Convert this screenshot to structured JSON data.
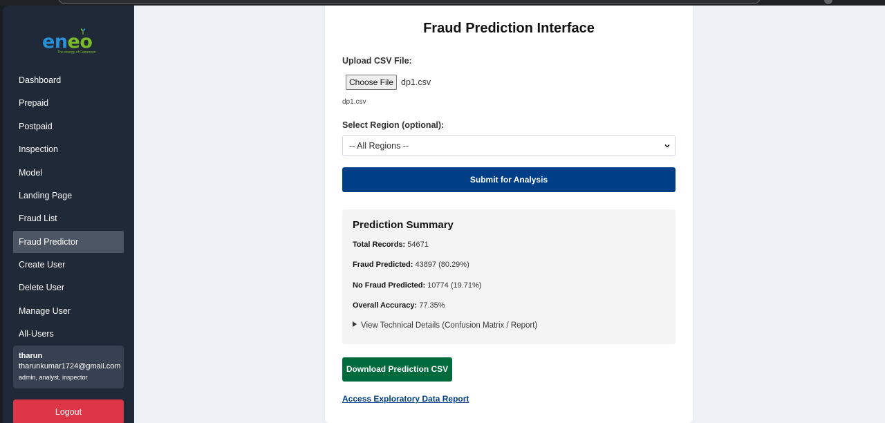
{
  "brand": {
    "logo_word": [
      "e",
      "n",
      "e",
      "o"
    ],
    "tagline": "The energy of Cameroon"
  },
  "sidebar": {
    "items": [
      {
        "label": "Dashboard",
        "active": false
      },
      {
        "label": "Prepaid",
        "active": false
      },
      {
        "label": "Postpaid",
        "active": false
      },
      {
        "label": "Inspection",
        "active": false
      },
      {
        "label": "Model",
        "active": false
      },
      {
        "label": "Landing Page",
        "active": false
      },
      {
        "label": "Fraud List",
        "active": false
      },
      {
        "label": "Fraud Predictor",
        "active": true
      },
      {
        "label": "Create User",
        "active": false
      },
      {
        "label": "Delete User",
        "active": false
      },
      {
        "label": "Manage User",
        "active": false
      },
      {
        "label": "All-Users",
        "active": false
      }
    ],
    "user": {
      "name": "tharun",
      "email": "tharunkumar1724@gmail.com",
      "roles": "admin, analyst, inspector"
    },
    "logout_label": "Logout"
  },
  "main": {
    "title": "Fraud Prediction Interface",
    "upload": {
      "label": "Upload CSV File:",
      "button": "Choose File",
      "file_name": "dp1.csv",
      "note": "dp1.csv"
    },
    "region": {
      "label": "Select Region (optional):",
      "selected": "-- All Regions --"
    },
    "submit_label": "Submit for Analysis",
    "summary": {
      "heading": "Prediction Summary",
      "total_label": "Total Records:",
      "total_value": "54671",
      "fraud_label": "Fraud Predicted:",
      "fraud_value": "43897 (80.29%)",
      "nofraud_label": "No Fraud Predicted:",
      "nofraud_value": "10774 (19.71%)",
      "accuracy_label": "Overall Accuracy:",
      "accuracy_value": "77.35%",
      "details_label": "View Technical Details (Confusion Matrix / Report)"
    },
    "download_label": "Download Prediction CSV",
    "report_link": "Access Exploratory Data Report"
  },
  "colors": {
    "sidebar": "#1f2937",
    "active": "#4b5563",
    "primary": "#003f88",
    "download": "#006b3c",
    "logout": "#dc3545"
  }
}
